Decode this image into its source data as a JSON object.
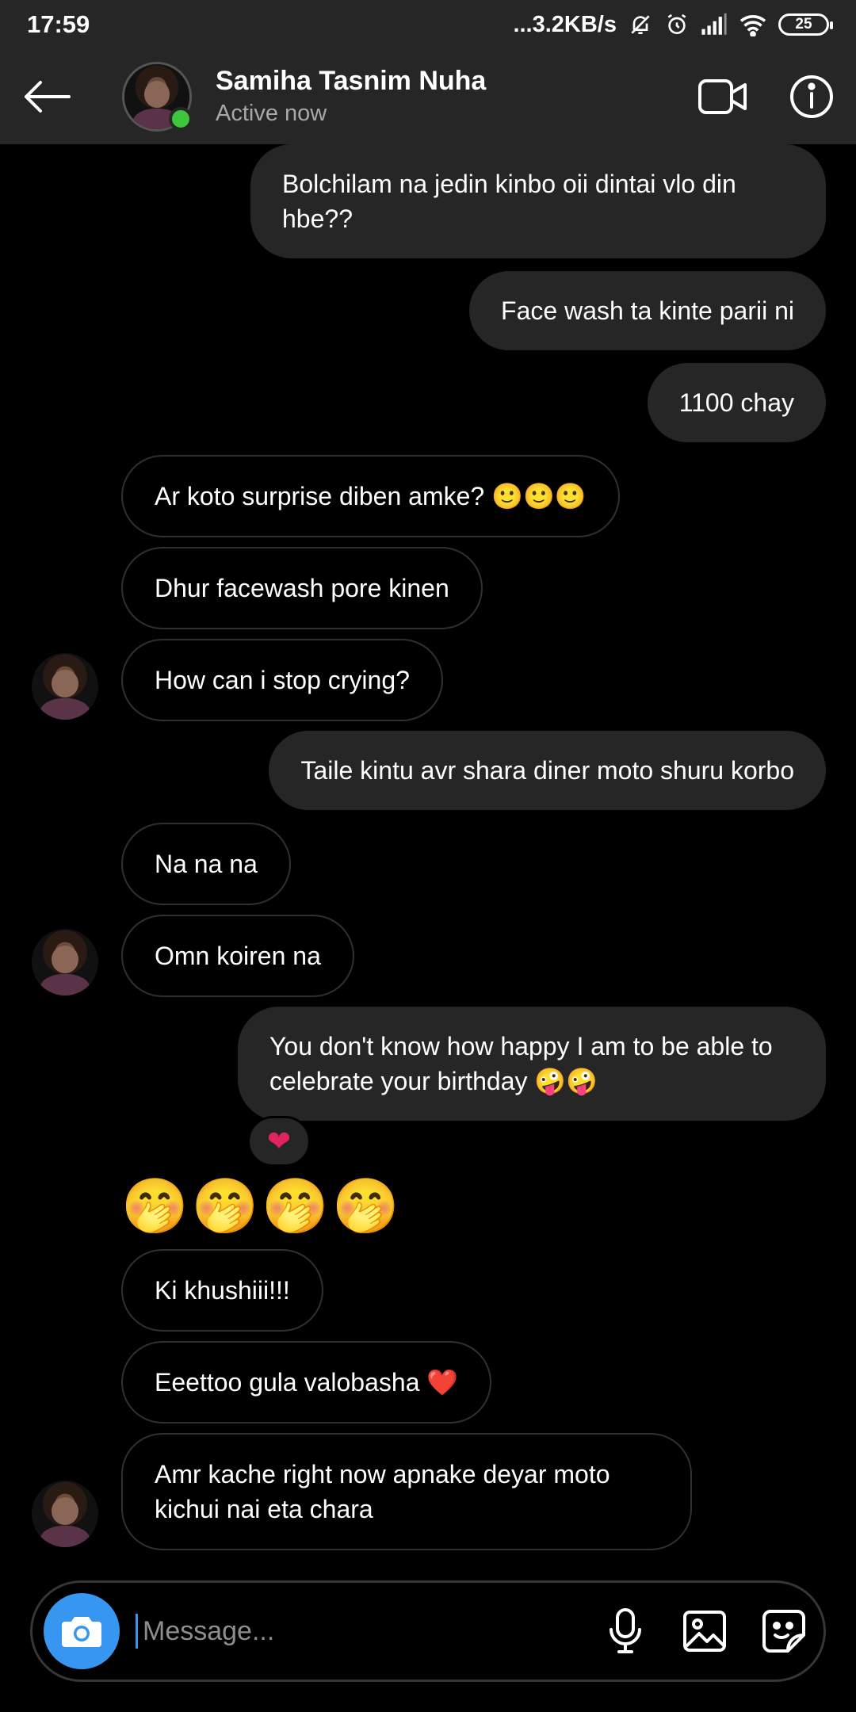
{
  "status_bar": {
    "time": "17:59",
    "network_speed": "...3.2KB/s",
    "battery": "25"
  },
  "header": {
    "contact_name": "Samiha Tasnim Nuha",
    "status": "Active now",
    "online_color": "#3ec63e"
  },
  "messages": [
    {
      "direction": "out",
      "text": "Bolchilam na jedin kinbo oii dintai vlo din hbe??"
    },
    {
      "direction": "out",
      "text": "Face wash ta kinte parii ni"
    },
    {
      "direction": "out",
      "text": "1100 chay"
    },
    {
      "direction": "in",
      "text": "Ar koto surprise diben amke? 🙂🙂🙂"
    },
    {
      "direction": "in",
      "text": "Dhur facewash pore kinen"
    },
    {
      "direction": "in",
      "text": "How can i stop crying?"
    },
    {
      "direction": "out",
      "text": "Taile kintu avr shara diner moto shuru korbo"
    },
    {
      "direction": "in",
      "text": "Na na na"
    },
    {
      "direction": "in",
      "text": "Omn koiren na"
    },
    {
      "direction": "out",
      "text": "You don't know how happy I am to be able to celebrate your birthday 🤪🤪",
      "reaction": "❤"
    },
    {
      "direction": "in",
      "text": "🤭🤭🤭🤭",
      "emoji_only": true
    },
    {
      "direction": "in",
      "text": "Ki khushiii!!!"
    },
    {
      "direction": "in",
      "text": "Eeettoo gula valobasha ❤️"
    },
    {
      "direction": "in",
      "text": "Amr kache right now apnake deyar moto kichui nai eta chara"
    }
  ],
  "composer": {
    "placeholder": "Message...",
    "accent_color": "#3797f0"
  },
  "icons": [
    "back-arrow-icon",
    "video-call-icon",
    "info-icon",
    "camera-icon",
    "microphone-icon",
    "gallery-icon",
    "sticker-icon"
  ]
}
